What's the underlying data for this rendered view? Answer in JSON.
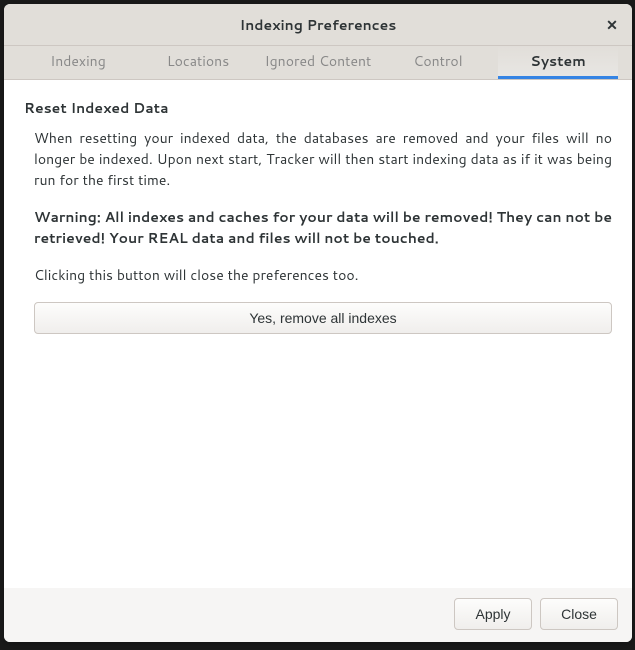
{
  "window": {
    "title": "Indexing Preferences"
  },
  "tabs": {
    "indexing": "Indexing",
    "locations": "Locations",
    "ignored": "Ignored Content",
    "control": "Control",
    "system": "System"
  },
  "section": {
    "title": "Reset Indexed Data",
    "para1": "When resetting your indexed data, the databases are removed and your files will no longer be indexed. Upon next start, Tracker will then start indexing data as if it was being run for the first time.",
    "warning": "Warning: All indexes and caches for your data will be removed! They can not be retrieved! Your REAL data and files will not be touched.",
    "para2": "Clicking this button will close the preferences too.",
    "button_label": "Yes, remove all indexes"
  },
  "footer": {
    "apply": "Apply",
    "close": "Close"
  }
}
